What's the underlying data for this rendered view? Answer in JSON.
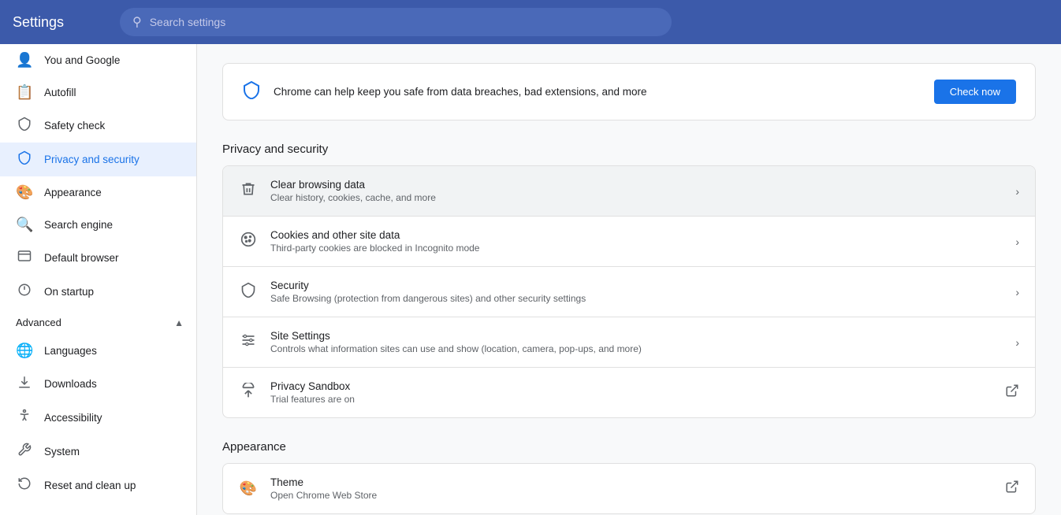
{
  "topbar": {
    "title": "Settings",
    "search_placeholder": "Search settings"
  },
  "sidebar": {
    "items": [
      {
        "id": "you-and-google",
        "label": "You and Google",
        "icon": "👤"
      },
      {
        "id": "autofill",
        "label": "Autofill",
        "icon": "📋"
      },
      {
        "id": "safety-check",
        "label": "Safety check",
        "icon": "🛡"
      },
      {
        "id": "privacy-and-security",
        "label": "Privacy and security",
        "icon": "🔒",
        "active": true
      },
      {
        "id": "appearance",
        "label": "Appearance",
        "icon": "🎨"
      },
      {
        "id": "search-engine",
        "label": "Search engine",
        "icon": "🔍"
      },
      {
        "id": "default-browser",
        "label": "Default browser",
        "icon": "🖥"
      },
      {
        "id": "on-startup",
        "label": "On startup",
        "icon": "⏻"
      }
    ],
    "advanced_section": "Advanced",
    "advanced_items": [
      {
        "id": "languages",
        "label": "Languages",
        "icon": "🌐"
      },
      {
        "id": "downloads",
        "label": "Downloads",
        "icon": "⬇"
      },
      {
        "id": "accessibility",
        "label": "Accessibility",
        "icon": "♿"
      },
      {
        "id": "system",
        "label": "System",
        "icon": "🔧"
      },
      {
        "id": "reset-and-clean",
        "label": "Reset and clean up",
        "icon": "🔄"
      }
    ]
  },
  "safety_banner": {
    "text": "Chrome can help keep you safe from data breaches, bad extensions, and more",
    "button_label": "Check now"
  },
  "privacy_section": {
    "title": "Privacy and security",
    "rows": [
      {
        "id": "clear-browsing-data",
        "title": "Clear browsing data",
        "subtitle": "Clear history, cookies, cache, and more",
        "icon": "🗑",
        "action": "chevron",
        "highlighted": true
      },
      {
        "id": "cookies-and-site-data",
        "title": "Cookies and other site data",
        "subtitle": "Third-party cookies are blocked in Incognito mode",
        "icon": "🍪",
        "action": "chevron",
        "highlighted": false
      },
      {
        "id": "security",
        "title": "Security",
        "subtitle": "Safe Browsing (protection from dangerous sites) and other security settings",
        "icon": "🛡",
        "action": "chevron",
        "highlighted": false
      },
      {
        "id": "site-settings",
        "title": "Site Settings",
        "subtitle": "Controls what information sites can use and show (location, camera, pop-ups, and more)",
        "icon": "⚙",
        "action": "chevron",
        "highlighted": false
      },
      {
        "id": "privacy-sandbox",
        "title": "Privacy Sandbox",
        "subtitle": "Trial features are on",
        "icon": "🧪",
        "action": "external",
        "highlighted": false
      }
    ]
  },
  "appearance_section": {
    "title": "Appearance",
    "rows": [
      {
        "id": "theme",
        "title": "Theme",
        "subtitle": "Open Chrome Web Store",
        "icon": "🎨",
        "action": "external",
        "highlighted": false
      }
    ]
  }
}
